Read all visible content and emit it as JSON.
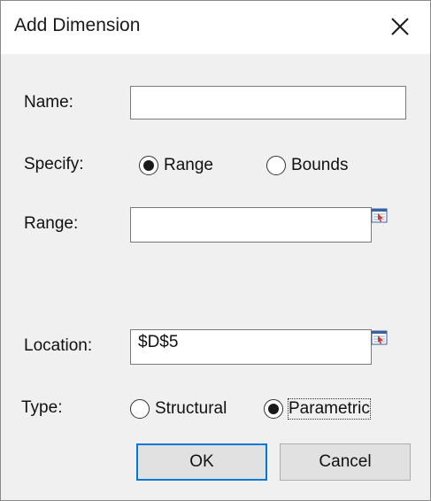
{
  "dialog": {
    "title": "Add Dimension",
    "close_icon": "close-icon"
  },
  "fields": {
    "name_label": "Name:",
    "name_value": "",
    "specify_label": "Specify:",
    "specify_options": [
      "Range",
      "Bounds"
    ],
    "specify_selected": "Range",
    "range_label": "Range:",
    "range_value": "",
    "location_label": "Location:",
    "location_value": "$D$5",
    "type_label": "Type:",
    "type_options": [
      "Structural",
      "Parametric"
    ],
    "type_selected": "Parametric"
  },
  "buttons": {
    "ok_label": "OK",
    "cancel_label": "Cancel"
  },
  "icons": {
    "range_ref": "range-selector-icon",
    "location_ref": "range-selector-icon"
  },
  "colors": {
    "default_button_border": "#0078d7",
    "dialog_bg": "#f0f0f0"
  }
}
